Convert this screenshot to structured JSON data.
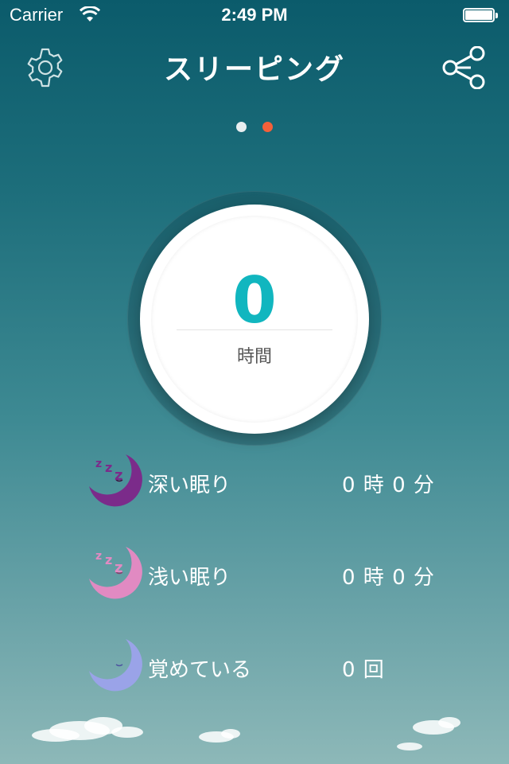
{
  "status_bar": {
    "carrier": "Carrier",
    "time": "2:49 PM"
  },
  "nav": {
    "title": "スリーピング"
  },
  "pager": {
    "page_count": 2,
    "active_index": 1,
    "active_color": "#f4603a",
    "inactive_color": "#e8eef0"
  },
  "summary": {
    "value": "0",
    "label": "時間",
    "value_color": "#11b6bf"
  },
  "stats": [
    {
      "label": "深い眠り",
      "value": "0 時 0 分",
      "icon": "deep-sleep-moon-icon",
      "color": "#7b2b8a"
    },
    {
      "label": "浅い眠り",
      "value": "0 時 0 分",
      "icon": "light-sleep-moon-icon",
      "color": "#e18ac2"
    },
    {
      "label": "覚めている",
      "value": "0 回",
      "icon": "awake-moon-icon",
      "color": "#9aa3e8"
    }
  ]
}
